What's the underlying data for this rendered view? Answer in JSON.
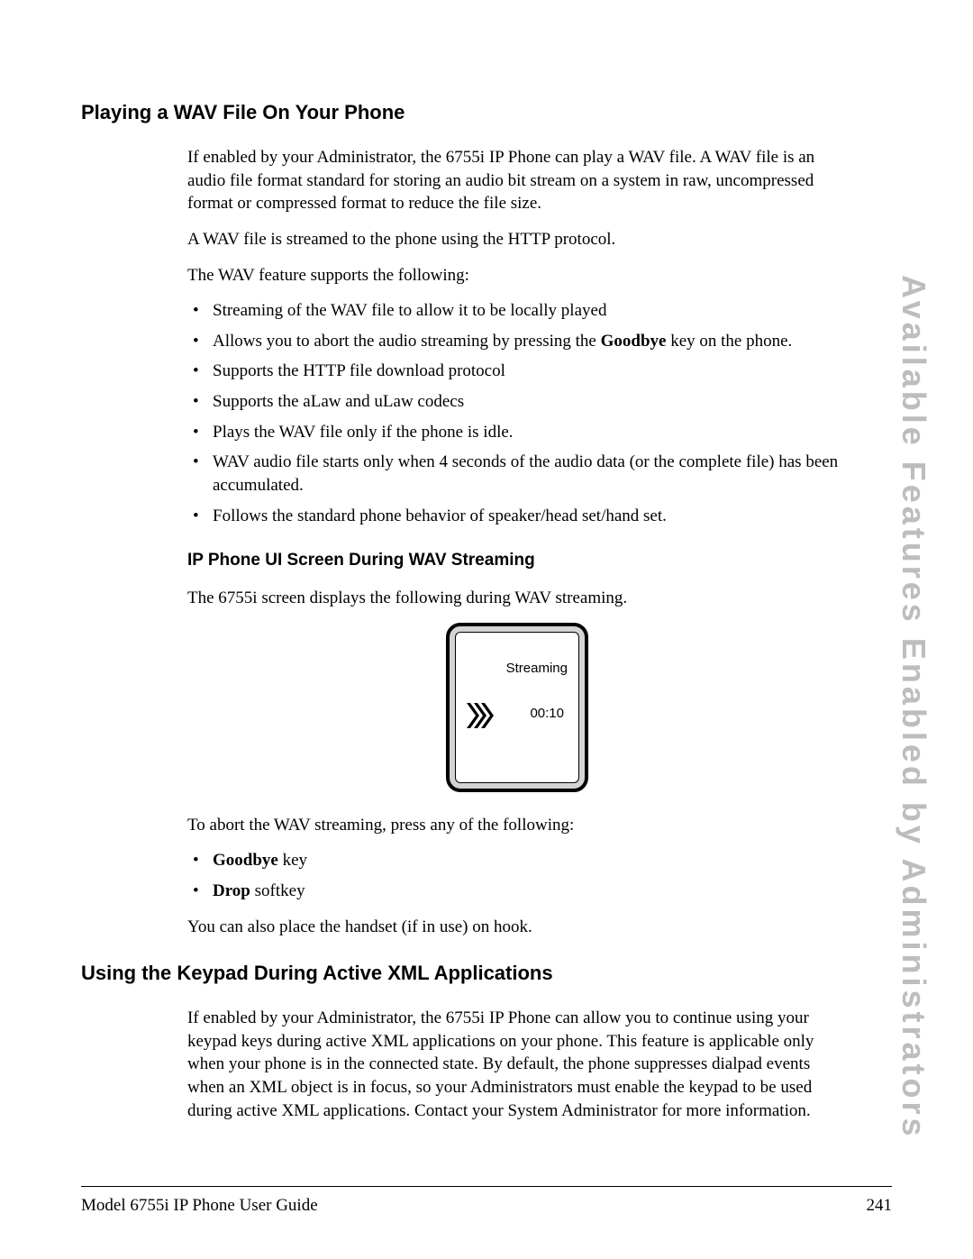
{
  "sideTitle": "Available Features Enabled by Administrators",
  "section1": {
    "heading": "Playing a WAV File On Your Phone",
    "p1": "If enabled by your Administrator, the 6755i IP Phone can play a WAV file. A WAV file is an audio file format standard for storing an audio bit stream on a system in raw, uncompressed format or compressed format to reduce the file size.",
    "p2": "A WAV file is streamed to the phone using the HTTP protocol.",
    "p3": "The WAV feature supports the following:",
    "bullets": [
      "Streaming of the WAV file to allow it to be locally played",
      "Allows you to abort the audio streaming by pressing the ",
      "Supports the HTTP file download protocol",
      "Supports the aLaw and uLaw codecs",
      "Plays the WAV file only if the phone is idle.",
      "WAV audio file starts only when 4 seconds of the audio data (or the complete file) has been accumulated.",
      "Follows the standard phone behavior of speaker/head set/hand set."
    ],
    "bullet2_bold": "Goodbye",
    "bullet2_tail": " key on the phone.",
    "subheading": "IP Phone UI Screen During WAV Streaming",
    "p4": "The 6755i screen displays the following during WAV streaming.",
    "phone": {
      "streaming": "Streaming",
      "time": "00:10"
    },
    "p5": "To abort the WAV streaming, press any of the following:",
    "abortBullets": [
      {
        "bold": "Goodbye",
        "tail": " key"
      },
      {
        "bold": "Drop",
        "tail": " softkey"
      }
    ],
    "p6": "You can also place the handset (if in use) on hook."
  },
  "section2": {
    "heading": "Using the Keypad During Active XML Applications",
    "p1": "If enabled by your Administrator, the 6755i IP Phone can allow you to continue using your keypad keys during active XML applications on your phone. This feature is applicable only when your phone is in the connected state. By default, the phone suppresses dialpad events when an XML object is in focus, so your Administrators must enable the keypad to be used during active XML applications. Contact your System Administrator for more information."
  },
  "footer": {
    "left": "Model 6755i IP Phone User Guide",
    "right": "241"
  }
}
